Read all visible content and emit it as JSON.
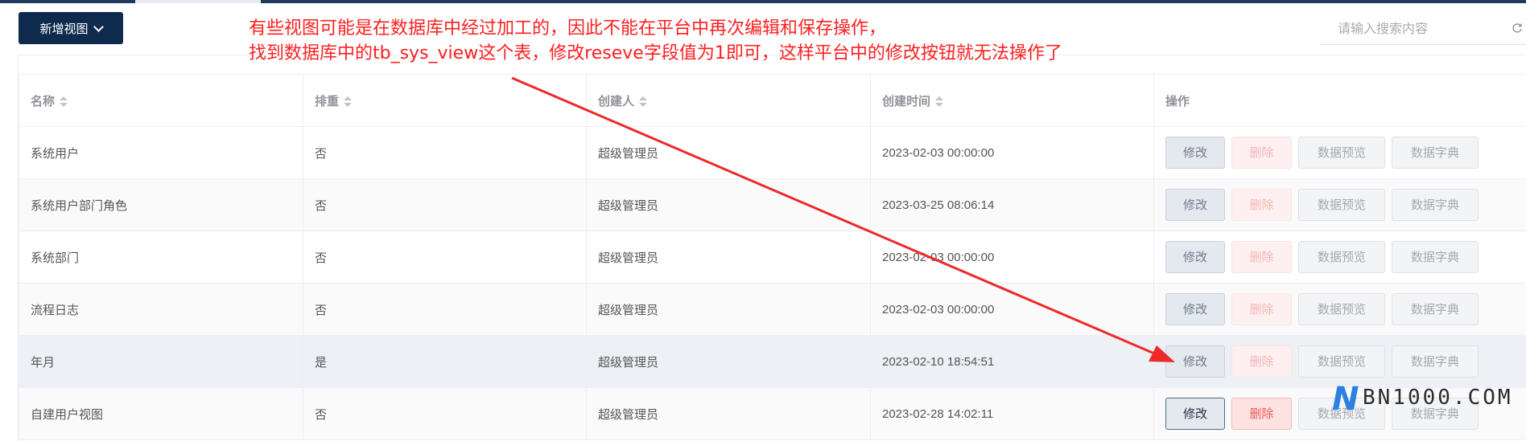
{
  "toolbar": {
    "add_view_label": "新增视图"
  },
  "search": {
    "placeholder": "请输入搜索内容"
  },
  "table": {
    "headers": {
      "name": "名称",
      "weight": "排重",
      "creator": "创建人",
      "created_time": "创建时间",
      "operations": "操作"
    },
    "rows": [
      {
        "name": "系统用户",
        "weight": "否",
        "creator": "超级管理员",
        "created_time": "2023-02-03 00:00:00"
      },
      {
        "name": "系统用户部门角色",
        "weight": "否",
        "creator": "超级管理员",
        "created_time": "2023-03-25 08:06:14"
      },
      {
        "name": "系统部门",
        "weight": "否",
        "creator": "超级管理员",
        "created_time": "2023-02-03 00:00:00"
      },
      {
        "name": "流程日志",
        "weight": "否",
        "creator": "超级管理员",
        "created_time": "2023-02-03 00:00:00"
      },
      {
        "name": "年月",
        "weight": "是",
        "creator": "超级管理员",
        "created_time": "2023-02-10 18:54:51"
      },
      {
        "name": "自建用户视图",
        "weight": "否",
        "creator": "超级管理员",
        "created_time": "2023-02-28 14:02:11"
      }
    ],
    "actions": {
      "edit": "修改",
      "delete": "删除",
      "preview": "数据预览",
      "dictionary": "数据字典"
    }
  },
  "annotation": {
    "line1": "有些视图可能是在数据库中经过加工的，因此不能在平台中再次编辑和保存操作，",
    "line2": "找到数据库中的tb_sys_view这个表，修改reseve字段值为1即可，这样平台中的修改按钮就无法操作了",
    "color": "#ff1f1f"
  },
  "watermark": {
    "letter": "N",
    "text": "BN1000.COM"
  },
  "colors": {
    "primary": "#0e2a4d",
    "danger": "#f56c6c",
    "header_text": "#909399"
  }
}
